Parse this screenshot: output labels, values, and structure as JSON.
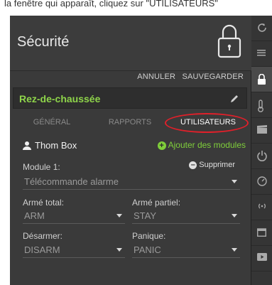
{
  "caption": "la fenêtre qui apparaît, cliquez sur \"UTILISATEURS\"",
  "panel": {
    "title": "Sécurité",
    "actions": {
      "cancel": "ANNULER",
      "save": "SAUVEGARDER"
    },
    "floor": "Rez-de-chaussée",
    "tabs": [
      "GÉNÉRAL",
      "RAPPORTS",
      "UTILISATEURS"
    ],
    "highlight_color": "#e0202a"
  },
  "user": {
    "name": "Thom Box",
    "add_modules": "Ajouter des modules"
  },
  "module": {
    "label": "Module 1:",
    "delete": "Supprimer",
    "type_value": "Télécommande alarme",
    "armed_total_label": "Armé total:",
    "armed_total_value": "ARM",
    "armed_partial_label": "Armé partiel:",
    "armed_partial_value": "STAY",
    "disarm_label": "Désarmer:",
    "disarm_value": "DISARM",
    "panic_label": "Panique:",
    "panic_value": "PANIC"
  },
  "rail_icons": [
    "refresh-icon",
    "menu-icon",
    "lock-icon",
    "thermometer-icon",
    "scene-icon",
    "power-icon",
    "gauge-icon",
    "wireless-icon",
    "calendar-icon",
    "video-icon"
  ]
}
